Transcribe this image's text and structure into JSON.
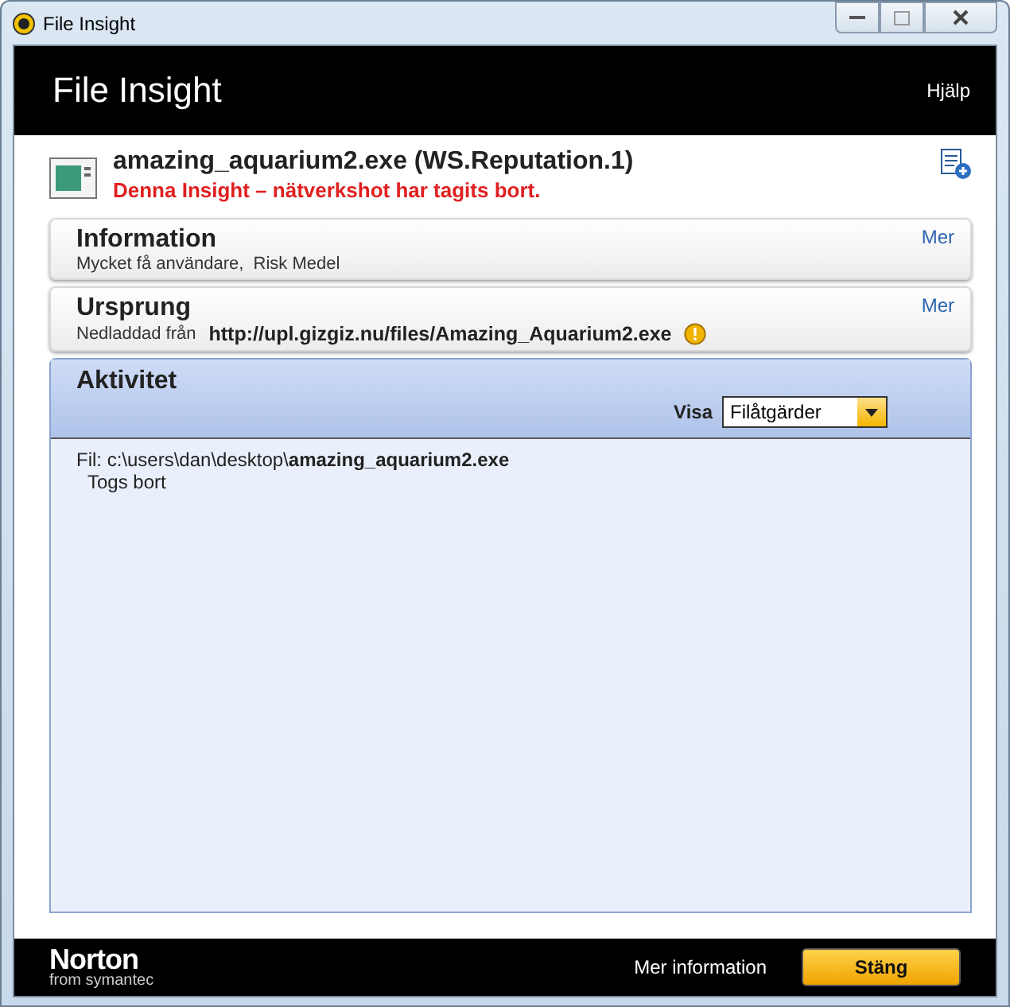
{
  "window": {
    "title": "File Insight"
  },
  "header": {
    "title": "File Insight",
    "help": "Hjälp"
  },
  "file": {
    "name": "amazing_aquarium2.exe (WS.Reputation.1)",
    "warning": "Denna Insight – nätverkshot har tagits bort."
  },
  "sections": [
    {
      "kind": "info",
      "title": "Information",
      "more": "Mer",
      "detail": "Mycket få användare,  Risk Medel"
    },
    {
      "kind": "origin",
      "title": "Ursprung",
      "more": "Mer",
      "detail": "Nedladdad från",
      "link": "http://upl.gizgiz.nu/files/Amazing_Aquarium2.exe"
    }
  ],
  "activity": {
    "title": "Aktivitet",
    "filter_label": "Visa",
    "filter_value": "Filåtgärder",
    "path_label": "Fil: c:\\users\\dan\\desktop\\",
    "path_file": "amazing_aquarium2.exe",
    "status": "Togs bort"
  },
  "footer": {
    "brand": "Norton",
    "brand_sub": "from symantec",
    "more_info": "Mer information",
    "close": "Stäng"
  }
}
